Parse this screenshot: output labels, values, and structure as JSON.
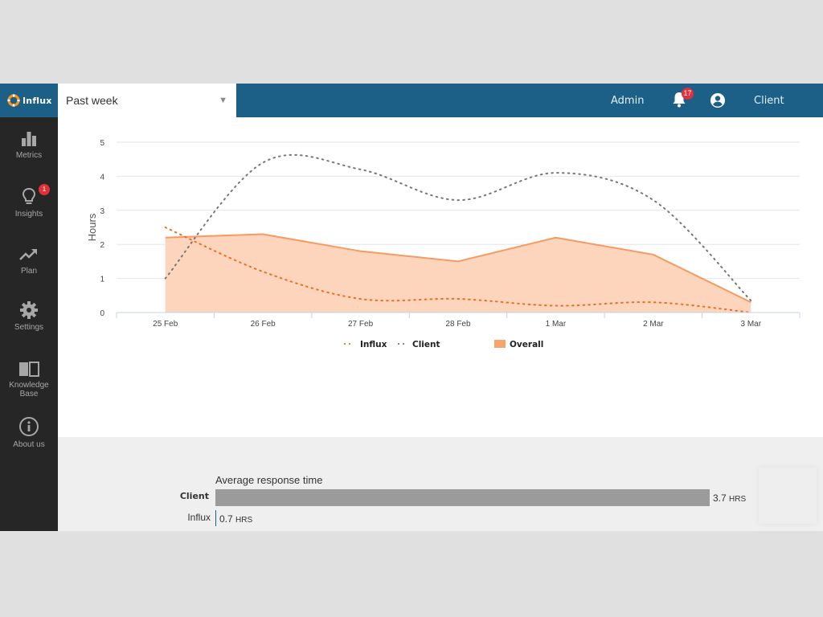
{
  "header": {
    "logo_text": "Influx",
    "range_selected": "Past week",
    "admin_label": "Admin",
    "notifications_count": "17",
    "client_label": "Client"
  },
  "sidebar": {
    "items": [
      {
        "label": "Metrics",
        "icon": "bar-chart-icon"
      },
      {
        "label": "Insights",
        "icon": "lightbulb-icon",
        "badge": "1"
      },
      {
        "label": "Plan",
        "icon": "trending-up-icon"
      },
      {
        "label": "Settings",
        "icon": "gear-icon"
      },
      {
        "label": "Knowledge",
        "label2": "Base",
        "icon": "book-icon"
      },
      {
        "label": "About us",
        "icon": "info-icon"
      }
    ]
  },
  "colors": {
    "brand": "#1c6087",
    "influx": "#f26b21",
    "client": "#777777",
    "overall_fill": "#fcd3b8",
    "overall_line": "#f79a62",
    "legend_overall": "#f9a46c"
  },
  "chart_data": {
    "type": "area",
    "title": "",
    "xlabel": "",
    "ylabel": "Hours",
    "ylim": [
      0,
      5
    ],
    "yticks": [
      0,
      1,
      2,
      3,
      4,
      5
    ],
    "grid": true,
    "legend_position": "bottom",
    "categories": [
      "25 Feb",
      "26 Feb",
      "27 Feb",
      "28 Feb",
      "1 Mar",
      "2 Mar",
      "3 Mar"
    ],
    "series": [
      {
        "name": "Influx",
        "style": "dotted-line",
        "values": [
          2.5,
          1.2,
          0.4,
          0.4,
          0.2,
          0.3,
          0.0
        ]
      },
      {
        "name": "Client",
        "style": "dotted-line",
        "values": [
          1.0,
          4.4,
          4.2,
          3.3,
          4.1,
          3.3,
          0.35
        ]
      },
      {
        "name": "Overall",
        "style": "area",
        "values": [
          2.2,
          2.3,
          1.8,
          1.5,
          2.2,
          1.7,
          0.3
        ]
      }
    ]
  },
  "response": {
    "title": "Average response time",
    "rows": [
      {
        "label": "Client",
        "value": 3.7,
        "value_text": "3.7",
        "unit": "HRS"
      },
      {
        "label": "Influx",
        "value": 0.7,
        "value_text": "0.7",
        "unit": "HRS"
      }
    ]
  }
}
